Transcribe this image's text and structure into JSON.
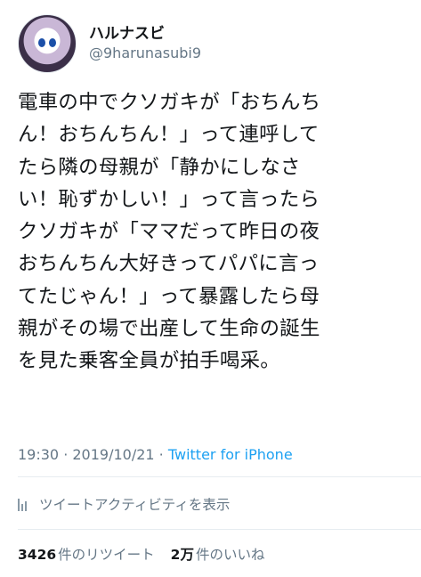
{
  "user": {
    "display_name": "ハルナスビ",
    "handle": "@9harunasubi9"
  },
  "tweet": {
    "text_lines": [
      "電車の中でクソガキが「おちんち",
      "ん！おちんちん！」って連呼して",
      "たら隣の母親が「静かにしなさ",
      "い！恥ずかしい！」って言ったら",
      "クソガキが「ママだって昨日の夜",
      "おちんちん大好きってパパに言っ",
      "てたじゃん！」って暴露したら母",
      "親がその場で出産して生命の誕生",
      "を見た乗客全員が拍手喝采。"
    ],
    "time": "19:30",
    "separator": " · ",
    "date": "2019/10/21",
    "source": "Twitter for iPhone"
  },
  "activity": {
    "label": "ツイートアクティビティを表示",
    "icon": "bar-chart-icon"
  },
  "stats": {
    "retweets_count": "3426",
    "retweets_label": "件のリツイート",
    "likes_count": "2万",
    "likes_label": "件のいいね"
  },
  "colors": {
    "link": "#1da1f2",
    "secondary": "#657786",
    "text": "#14171a",
    "divider": "#e6ecf0"
  }
}
